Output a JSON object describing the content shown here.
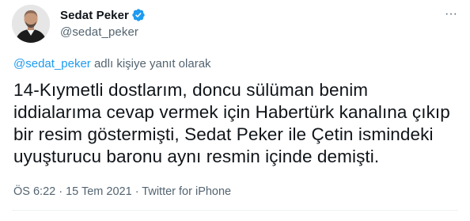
{
  "colors": {
    "text_primary": "#0f1419",
    "text_secondary": "#536471",
    "accent": "#1d9bf0",
    "divider": "#eff3f4"
  },
  "author": {
    "display_name": "Sedat Peker",
    "handle": "@sedat_peker",
    "verified_icon": "verified-badge-icon",
    "avatar_icon": "avatar"
  },
  "more_options": {
    "icon": "more-horizontal-icon",
    "glyph": "···"
  },
  "reply_context": {
    "mention": "@sedat_peker",
    "suffix": " adlı kişiye yanıt olarak"
  },
  "tweet": {
    "text": "14-Kıymetli dostlarım, doncu sülüman benim\niddialarıma cevap vermek için Habertürk kanalına çıkıp\nbir resim göstermişti, Sedat Peker ile Çetin ismindeki\nuyuşturucu baronu aynı resmin içinde demişti."
  },
  "meta": {
    "time": "ÖS 6:22",
    "separator": " · ",
    "date": "15 Tem 2021",
    "source": "Twitter for iPhone"
  }
}
